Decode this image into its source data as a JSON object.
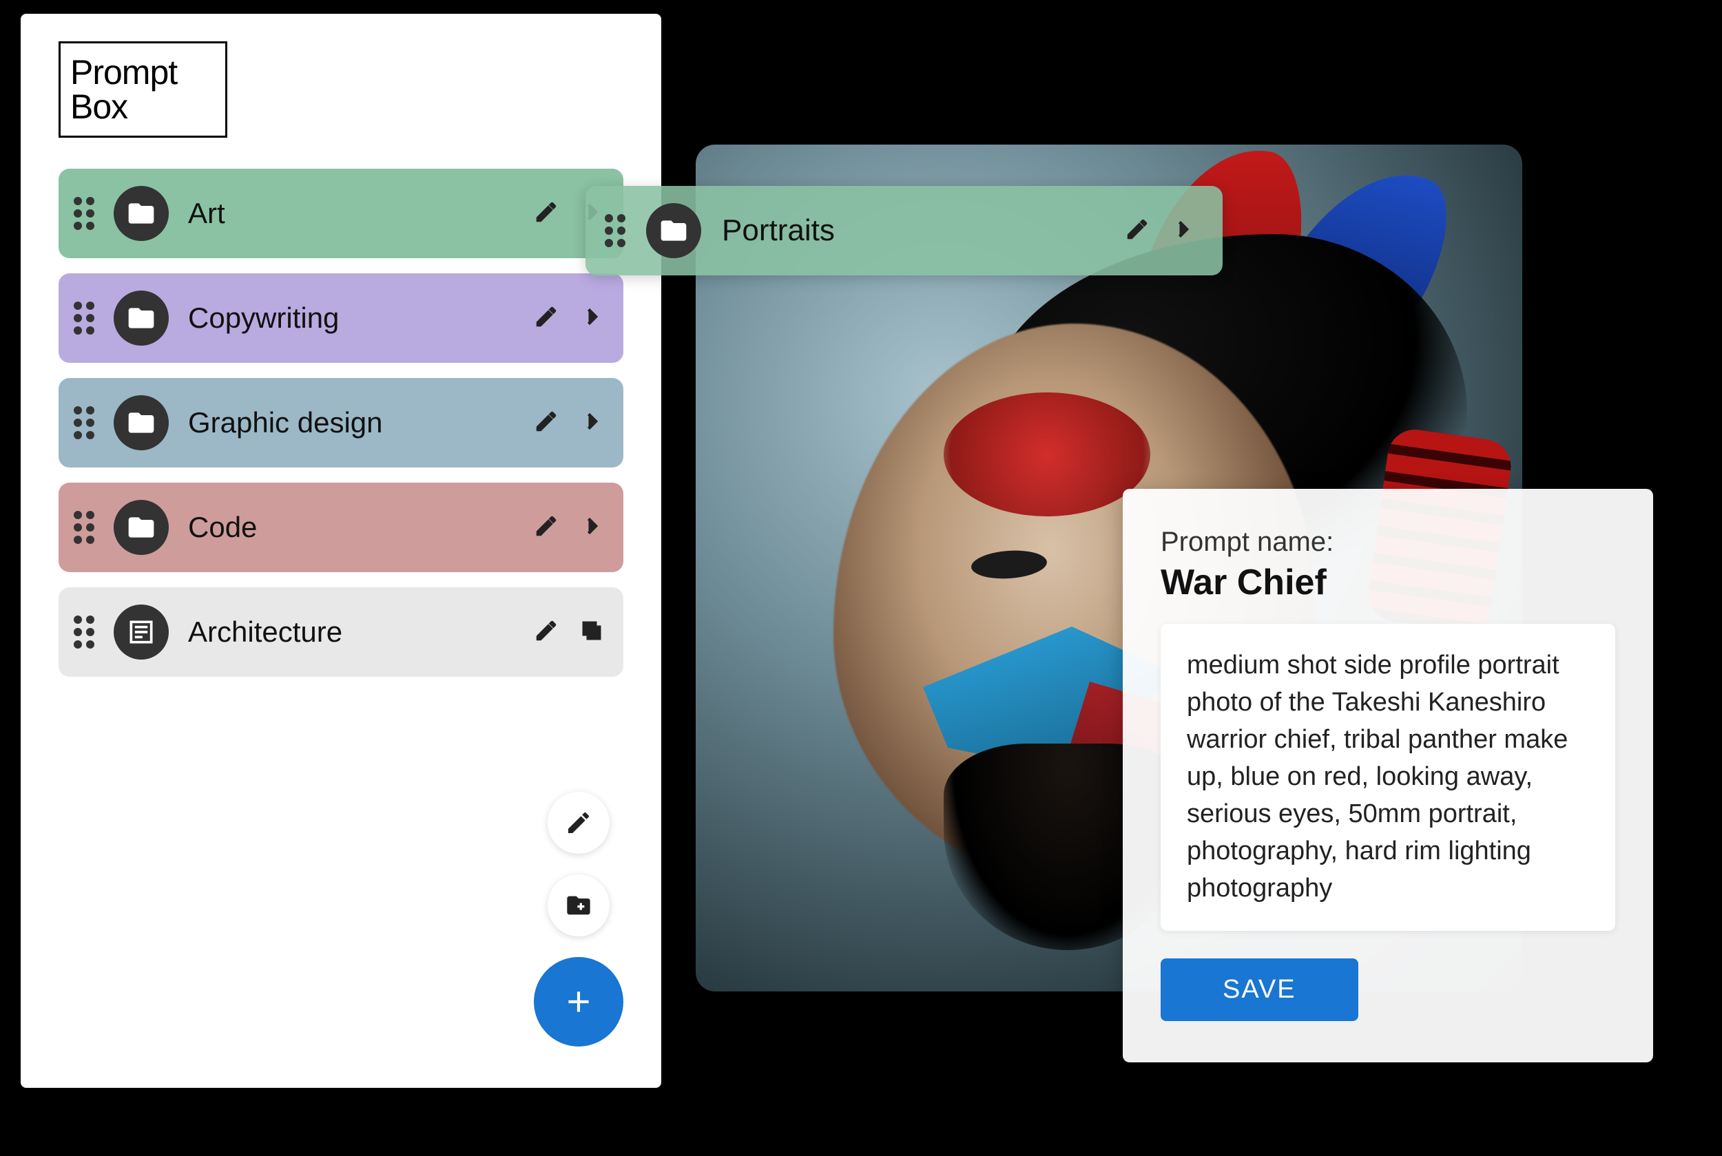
{
  "logo": {
    "line1": "Prompt",
    "line2": "Box"
  },
  "colors": {
    "art": "#8ac2a3",
    "copywriting": "#b9abe0",
    "graphic_design": "#9cb8c7",
    "code": "#cf9c9c",
    "architecture": "#e8e8e8",
    "subfolder": "rgba(138,194,163,0.88)",
    "fab": "#1976d2"
  },
  "folders": [
    {
      "label": "Art",
      "type": "folder",
      "trailing": "chevron",
      "color_key": "art"
    },
    {
      "label": "Copywriting",
      "type": "folder",
      "trailing": "chevron",
      "color_key": "copywriting"
    },
    {
      "label": "Graphic design",
      "type": "folder",
      "trailing": "chevron",
      "color_key": "graphic_design"
    },
    {
      "label": "Code",
      "type": "folder",
      "trailing": "chevron",
      "color_key": "code"
    },
    {
      "label": "Architecture",
      "type": "note",
      "trailing": "copy",
      "color_key": "architecture"
    }
  ],
  "subfolder": {
    "label": "Portraits"
  },
  "prompt": {
    "field_label": "Prompt name:",
    "name": "War Chief",
    "body": "medium shot side profile portrait photo of the Takeshi Kaneshiro warrior chief, tribal panther make up, blue on red, looking away, serious eyes, 50mm portrait, photography, hard rim lighting photography",
    "save_label": "SAVE"
  }
}
